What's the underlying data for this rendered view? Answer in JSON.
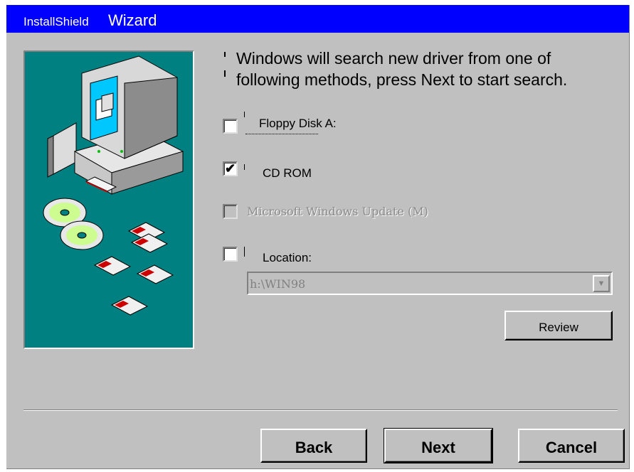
{
  "window": {
    "title_prefix": "InstallShield",
    "title_main": "Wizard"
  },
  "instructions": "Windows will search new driver from one of\nfollowing methods, press Next to start search.",
  "options": {
    "floppy": {
      "label": "Floppy Disk A:",
      "checked": false,
      "enabled": true,
      "mark": ""
    },
    "cdrom": {
      "label": "CD ROM",
      "checked": true,
      "enabled": true,
      "mark": "✔"
    },
    "windows_update": {
      "label": "Microsoft Windows Update (M)",
      "checked": false,
      "enabled": false,
      "mark": ""
    },
    "location": {
      "label": "Location:",
      "checked": false,
      "enabled": true,
      "mark": ""
    }
  },
  "location_combo": {
    "value": "h:\\WIN98",
    "arrow": "▼",
    "enabled": false
  },
  "buttons": {
    "review": "Review",
    "back": "Back",
    "next": "Next",
    "cancel": "Cancel"
  },
  "illustration": {
    "background_color": "#008080",
    "icons": [
      "computer-icon",
      "cd-disc-icon",
      "floppy-disk-icon"
    ]
  },
  "colors": {
    "titlebar": "#0000ff",
    "dialog": "#c0c0c0",
    "disabled_text": "#8a8a8a"
  }
}
